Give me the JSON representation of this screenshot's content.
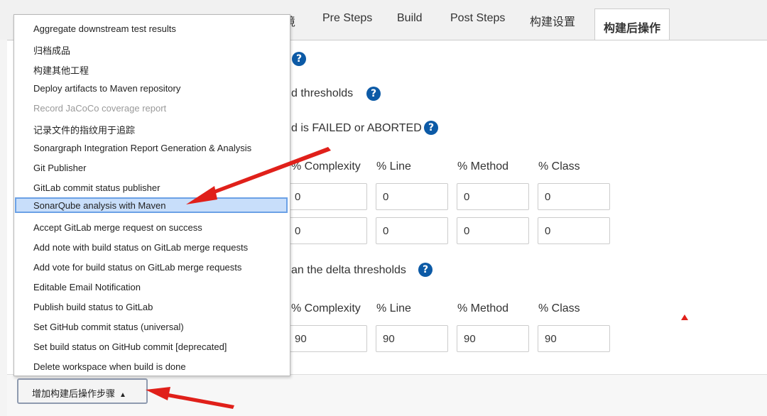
{
  "tabs": {
    "partial": "境",
    "items": [
      "Pre Steps",
      "Build",
      "Post Steps",
      "构建设置"
    ],
    "active": "构建后操作"
  },
  "panel": {
    "row1_help": "?",
    "thresholds_label": "d thresholds",
    "failed_label": "d is FAILED or ABORTED",
    "delta_label": "an the delta thresholds",
    "columns": [
      "% Complexity",
      "% Line",
      "% Method",
      "% Class"
    ],
    "group1": [
      [
        "0",
        "0",
        "0",
        "0"
      ],
      [
        "0",
        "0",
        "0",
        "0"
      ]
    ],
    "group2": [
      "90",
      "90",
      "90",
      "90"
    ]
  },
  "dropdown": {
    "items": [
      "Aggregate downstream test results",
      "归档成品",
      "构建其他工程",
      "Deploy artifacts to Maven repository",
      "Record JaCoCo coverage report",
      "记录文件的指纹用于追踪",
      "Sonargraph Integration Report Generation & Analysis",
      "Git Publisher",
      "GitLab commit status publisher",
      "SonarQube analysis with Maven",
      "Accept GitLab merge request on success",
      "Add note with build status on GitLab merge requests",
      "Add vote for build status on GitLab merge requests",
      "Editable Email Notification",
      "Publish build status to GitLab",
      "Set GitHub commit status (universal)",
      "Set build status on GitHub commit [deprecated]",
      "Delete workspace when build is done"
    ],
    "disabled_index": 4,
    "selected_index": 9
  },
  "add_step_button": {
    "label": "增加构建后操作步骤",
    "caret": "▲"
  },
  "colors": {
    "accent": "#0c5aa6",
    "annotation_arrow": "#e0201a",
    "selection": "#c8defa"
  },
  "icons": {
    "help": "help-circle-icon",
    "caret": "caret-up-icon",
    "marker": "red-triangle-icon"
  }
}
